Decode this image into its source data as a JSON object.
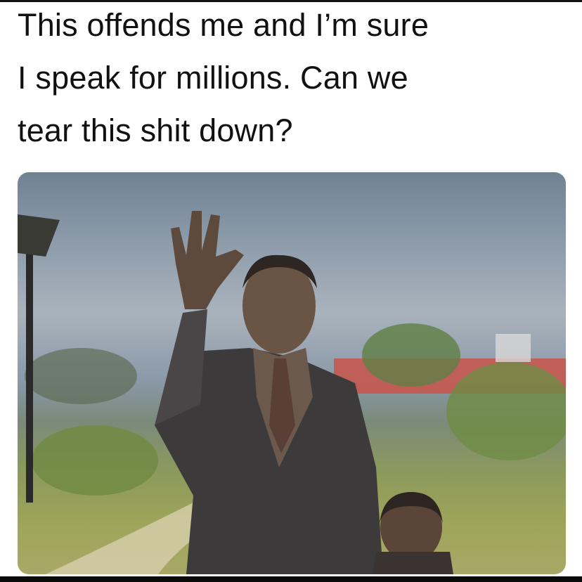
{
  "caption": {
    "lines": [
      "This offends me and I’m sure",
      "I speak for millions. Can we",
      "tear this shit down?"
    ]
  },
  "photo": {
    "subject": "bronze-statue-waving"
  }
}
